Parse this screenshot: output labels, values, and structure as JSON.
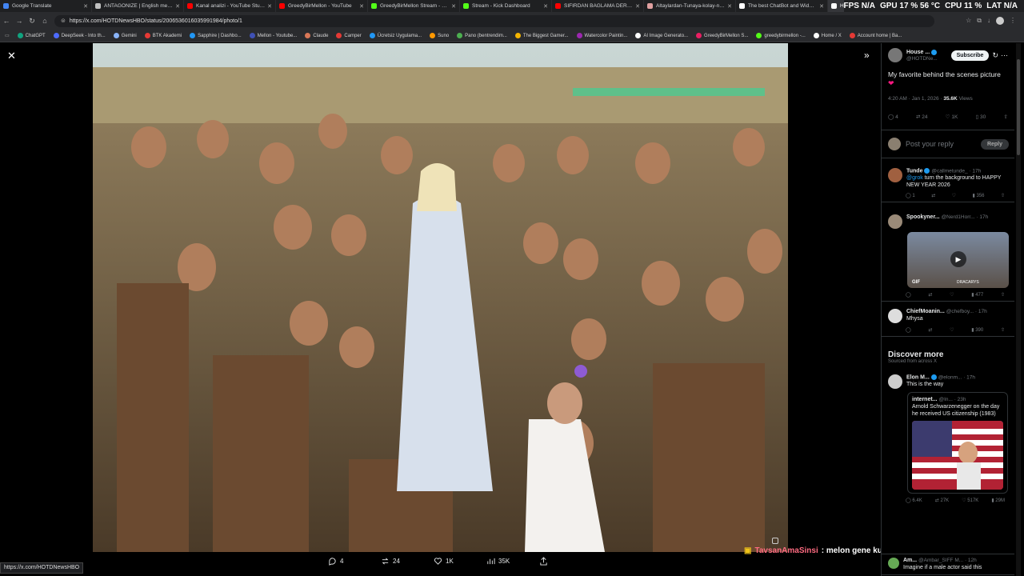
{
  "browser": {
    "tabs": [
      {
        "title": "Google Translate",
        "color": "#4285f4"
      },
      {
        "title": "ANTAGONIZE | English meaning",
        "color": "#c0c0c0"
      },
      {
        "title": "Kanal analizi - YouTube Studio",
        "color": "#ff0000"
      },
      {
        "title": "GreedyBirMellon - YouTube",
        "color": "#ff0000"
      },
      {
        "title": "GreedyBirMellon Stream - Watch",
        "color": "#53fc18"
      },
      {
        "title": "Stream - Kick Dashboard",
        "color": "#53fc18"
      },
      {
        "title": "SIFIRDAN BAĞLAMA DERSLERİ",
        "color": "#ff0000"
      },
      {
        "title": "Altaylardan-Tunaya-kolay-nota",
        "color": "#e0a0a0"
      },
      {
        "title": "The best ChatBot and Widgets",
        "color": "#ffffff"
      },
      {
        "title": "Home / X",
        "color": "#ffffff"
      }
    ],
    "hud": {
      "fps": "FPS",
      "fps_val": "N/A",
      "gpu": "GPU",
      "gpu_val": "17 %  56 °C",
      "cpu": "CPU",
      "cpu_val": "11 %",
      "lat": "LAT",
      "lat_val": "N/A"
    },
    "url": "https://x.com/HOTDNewsHBO/status/2006536016035991984/photo/1",
    "bookmarks": [
      {
        "label": "ChatGPT",
        "color": "#10a37f"
      },
      {
        "label": "DeepSeek - Into th...",
        "color": "#4d6bfe"
      },
      {
        "label": "Gemini",
        "color": "#8ab4f8"
      },
      {
        "label": "BTK Akademi",
        "color": "#e53935"
      },
      {
        "label": "Sapphire | Dashbo...",
        "color": "#2196f3"
      },
      {
        "label": "Mellon - Youtube...",
        "color": "#3f51b5"
      },
      {
        "label": "Claude",
        "color": "#d97757"
      },
      {
        "label": "Camper",
        "color": "#e53935"
      },
      {
        "label": "Ücretsiz Uygulama...",
        "color": "#2196f3"
      },
      {
        "label": "Suno",
        "color": "#ff9800"
      },
      {
        "label": "Pano (bentrendim...",
        "color": "#4caf50"
      },
      {
        "label": "The Biggest Gamer...",
        "color": "#f4b400"
      },
      {
        "label": "Watercolor Paintin...",
        "color": "#9c27b0"
      },
      {
        "label": "AI Image Generato...",
        "color": "#fff"
      },
      {
        "label": "GreedyBirMellon S...",
        "color": "#e91e63"
      },
      {
        "label": "greedybirmellon -...",
        "color": "#53fc18"
      },
      {
        "label": "Home / X",
        "color": "#fff"
      },
      {
        "label": "Account home | Ba...",
        "color": "#e53935"
      }
    ],
    "status_url": "https://x.com/HOTDNewsHBO"
  },
  "viewer": {
    "actions": {
      "reply": "4",
      "repost": "24",
      "like": "1K",
      "views": "35K"
    }
  },
  "chat_overlay": {
    "user": "TavsanAmaSinsi",
    "message": ": melon gene kudurdu am k"
  },
  "post": {
    "author": "House ...",
    "handle": "@HOTDNe...",
    "subscribe": "Subscribe",
    "text": "My favorite behind the scenes picture",
    "time": "4:20 AM · Jan 1, 2026 ·",
    "views": "35.6K",
    "views_label": "Views",
    "stats": {
      "reply": "4",
      "repost": "24",
      "like": "1K",
      "bookmark": "30"
    },
    "reply_placeholder": "Post your reply",
    "reply_button": "Reply"
  },
  "replies": [
    {
      "name": "Tunde",
      "handle": "@callmetunde_ · 17h",
      "mention": "@grok",
      "text": " turn the background to HAPPY NEW YEAR 2026",
      "reply": "1",
      "like": "",
      "views": "356"
    },
    {
      "name": "Spookyner...",
      "handle": "@Nerd1Horr... · 17h",
      "gif_badge": "GIF",
      "gif_caption": "DRACARYS",
      "reply": "",
      "like": "",
      "views": "477"
    },
    {
      "name": "ChiefMoanin...",
      "handle": "@chefboy... · 17h",
      "text": "Mhysa",
      "reply": "",
      "like": "",
      "views": "390"
    }
  ],
  "discover": {
    "heading": "Discover more",
    "sub": "Sourced from across X",
    "post": {
      "name": "Elon M...",
      "handle": "@elonm... · 17h",
      "text": "This is the way",
      "quote": {
        "name": "internet...",
        "handle": "@In... · 23h",
        "text": "Arnold Schwarzenegger on the day he received US citizenship (1983)"
      },
      "reply": "6.4K",
      "repost": "27K",
      "like": "517K",
      "views": "29M"
    },
    "next": {
      "name": "Am...",
      "handle": "@Ambar_SIFF M... · 12h",
      "text": "Imagine if a male actor said this"
    }
  }
}
